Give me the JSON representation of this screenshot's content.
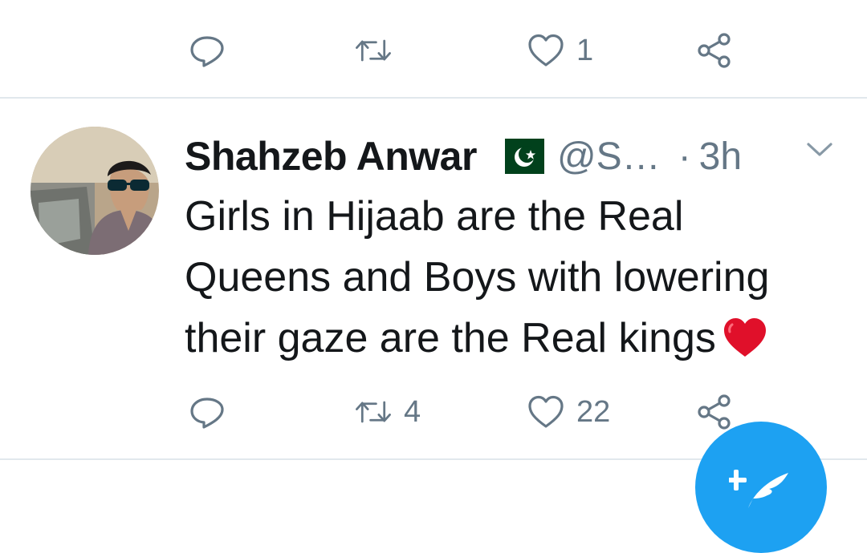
{
  "prev_tweet": {
    "actions": {
      "reply": {
        "icon": "reply-icon",
        "count": ""
      },
      "retweet": {
        "icon": "retweet-icon",
        "count": ""
      },
      "like": {
        "icon": "heart-icon",
        "count": "1"
      },
      "share": {
        "icon": "share-icon",
        "count": ""
      }
    }
  },
  "tweet": {
    "author": {
      "display_name": "Shahzeb Anwar",
      "flag_icon": "pakistan-flag-icon",
      "handle": "@S…",
      "separator": "·",
      "time": "3h"
    },
    "text_lines": [
      "Girls in Hijaab are the Real",
      "Queens and Boys with lowering",
      "their gaze are the Real kings"
    ],
    "trailing_emoji": "red-heart-icon",
    "actions": {
      "reply": {
        "icon": "reply-icon",
        "count": ""
      },
      "retweet": {
        "icon": "retweet-icon",
        "count": "4"
      },
      "like": {
        "icon": "heart-icon",
        "count": "22"
      },
      "share": {
        "icon": "share-icon",
        "count": ""
      }
    },
    "menu_icon": "chevron-down-icon"
  },
  "fab": {
    "icon": "compose-tweet-icon"
  },
  "colors": {
    "text": "#14171a",
    "muted": "#657786",
    "divider": "#e1e8ed",
    "accent": "#1da1f2",
    "heart_red": "#e0102a",
    "flag_green": "#01411c"
  }
}
